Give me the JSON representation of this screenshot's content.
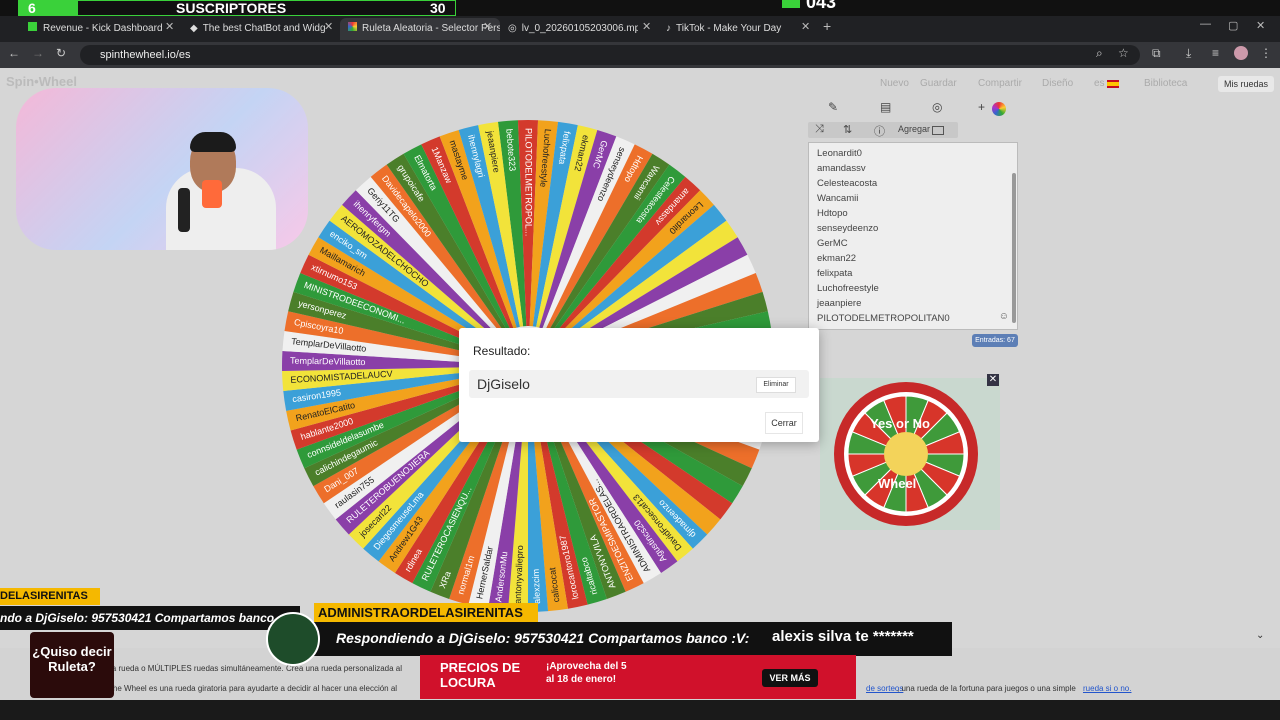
{
  "overlay": {
    "left_count": "6",
    "subs_label": "SUSCRIPTORES",
    "subs_value": "30",
    "right_value": "043"
  },
  "browser": {
    "tabs": [
      {
        "title": "Revenue - Kick Dashboard"
      },
      {
        "title": "The best ChatBot and Widgets"
      },
      {
        "title": "Ruleta Aleatoria - Selector Pers"
      },
      {
        "title": "lv_0_20260105203006.mp4"
      },
      {
        "title": "TikTok - Make Your Day"
      }
    ],
    "url": "spinthewheel.io/es"
  },
  "site": {
    "logo": "Spin•Wheel",
    "nav": [
      "Nuevo",
      "Guardar",
      "Compartir",
      "Diseño",
      "es",
      "Biblioteca"
    ],
    "my_wheels": "Mis ruedas",
    "add_label": "Agregar",
    "entries": [
      "Leonardit0",
      "amandassv",
      "Celesteacosta",
      "Wancamii",
      "Hdtopo",
      "senseydeenzo",
      "GerMC",
      "ekman22",
      "felixpata",
      "Luchofreestyle",
      "jeaanpiere",
      "PILOTODELMETROPOLITAN0"
    ],
    "entries_count": "Entradas: 67"
  },
  "wheel": {
    "labels": [
      "bebote323",
      "PILOTODELMETROPOL...",
      "Luchofreestyle",
      "felixpata",
      "ekman22",
      "GerMC",
      "senseydeenzo",
      "Hdtopo",
      "Wancamii",
      "Celesteacosta",
      "amandassv",
      "Leonardit0",
      "",
      "",
      "",
      "",
      "",
      "",
      "",
      "",
      "",
      "",
      "",
      "",
      "",
      "",
      "",
      "",
      "",
      "",
      "djmadeenzo",
      "DavidFonsecaf13",
      "Agustincs20",
      "ADMINISTRAORDELAS...",
      "ENZITOESMIPASTOR",
      "ANTONYVILA",
      "ricaltabco",
      "lorocantoro1987",
      "calicocat",
      "alexzcim",
      "antonyvaliepro",
      "AndersonMu",
      "HernerSaldar",
      "normal1m",
      "XRa",
      "RULETEROCASIENQU...",
      "rdinea",
      "Andrew1G43",
      "DiegosmeuseLma",
      "josecarl22",
      "RULETEROBUENOJIERA",
      "raulasin755",
      "Dani_007",
      "calichindegaumic",
      "connsideldelasumbe",
      "hablante2000",
      "RenatoElCatito",
      "casiron1995",
      "ECONOMISTADELAUCV",
      "TemplarDeVillaotto",
      "TemplarDeVillaotto",
      "Cpiscoyra10",
      "yersonperez",
      "MINISTRODEECONOMI...",
      "xtirnumo153",
      "Maillamarich",
      "enciko_sm",
      "AEROMOZADELCHOCHO",
      "ihenryfergm",
      "Geriy11TG",
      "Davidecapelo2000",
      "grupoicafe",
      "Elmatorta",
      "1Manzaw",
      "mastayme",
      "ihennylagri",
      "jeaanpiere"
    ]
  },
  "modal": {
    "title": "Resultado:",
    "winner": "DjGiselo",
    "remove": "Eliminar",
    "close": "Cerrar"
  },
  "ad": {
    "top": "Yes or No",
    "bottom": "Wheel"
  },
  "stream": {
    "left_tag": "DELASIRENITAS",
    "left_msg": "ndo a DjGiselo: 957530421 Compartamos banco",
    "name_tag": "ADMINISTRAORDELASIRENITAS",
    "msg": "Respondiendo a DjGiselo: 957530421 Compartamos banco :V:",
    "msg_tail": "alexis silva te *******",
    "corner": "¿Quiso decir Ruleta?",
    "promo_brand": "PRECIOS DE LOCURA",
    "promo_text": "¡Aprovecha del 5 al 18 de enero!",
    "promo_btn": "VER MÁS",
    "footer_1": "la rueda o MÚLTIPLES ruedas simultáneamente. Crea una rueda personalizada al",
    "footer_2": "n the Wheel es una rueda giratoria para ayudarte a decidir al hacer una elección al",
    "footer_link1": "de sorteos",
    "footer_mid": ", una rueda de la fortuna para juegos o una simple",
    "footer_link2": "rueda si o no."
  }
}
